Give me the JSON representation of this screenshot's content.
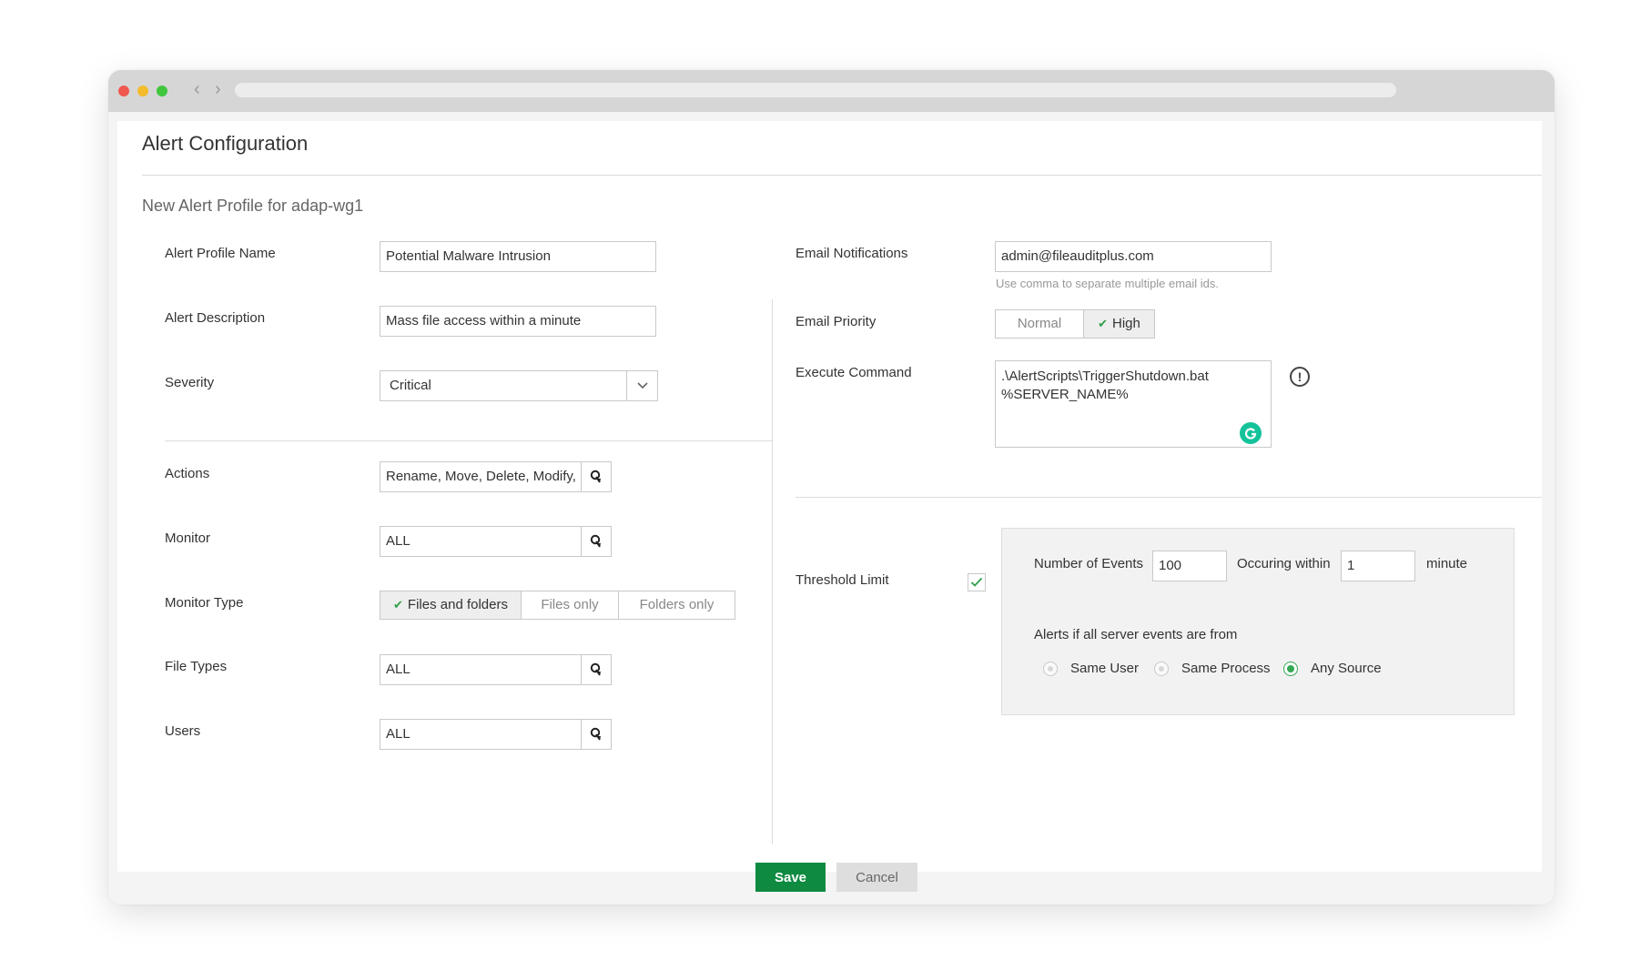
{
  "browser": {
    "back_glyph": "‹",
    "forward_glyph": "›"
  },
  "page": {
    "title": "Alert Configuration",
    "subtitle": "New Alert Profile for adap-wg1"
  },
  "left": {
    "profile_name": {
      "label": "Alert Profile Name",
      "value": "Potential Malware Intrusion"
    },
    "description": {
      "label": "Alert Description",
      "value": "Mass file access within a minute"
    },
    "severity": {
      "label": "Severity",
      "value": "Critical"
    },
    "actions": {
      "label": "Actions",
      "value": "Rename, Move, Delete, Modify, Create"
    },
    "monitor": {
      "label": "Monitor",
      "value": "ALL"
    },
    "monitor_type": {
      "label": "Monitor Type",
      "options": [
        "Files and folders",
        "Files only",
        "Folders only"
      ],
      "selected": "Files and folders"
    },
    "file_types": {
      "label": "File Types",
      "value": "ALL"
    },
    "users": {
      "label": "Users",
      "value": "ALL"
    }
  },
  "right": {
    "email": {
      "label": "Email Notifications",
      "value": "admin@fileauditplus.com",
      "hint": "Use comma to separate multiple email ids."
    },
    "priority": {
      "label": "Email Priority",
      "options": [
        "Normal",
        "High"
      ],
      "selected": "High"
    },
    "command": {
      "label": "Execute Command",
      "line1": ".\\AlertScripts\\TriggerShutdown.bat",
      "line2": "%SERVER_NAME%"
    },
    "threshold": {
      "label": "Threshold Limit",
      "checked": true,
      "events_label": "Number of Events",
      "events_value": "100",
      "within_label": "Occuring within",
      "within_value": "1",
      "unit": "minute",
      "source_label": "Alerts if all server events are from",
      "sources": [
        "Same User",
        "Same Process",
        "Any Source"
      ],
      "selected_source": "Any Source"
    }
  },
  "buttons": {
    "save": "Save",
    "cancel": "Cancel"
  },
  "colors": {
    "accent": "#0e8a41",
    "check": "#2e9e47",
    "radio_on": "#34a853",
    "grammarly": "#15c39a"
  }
}
